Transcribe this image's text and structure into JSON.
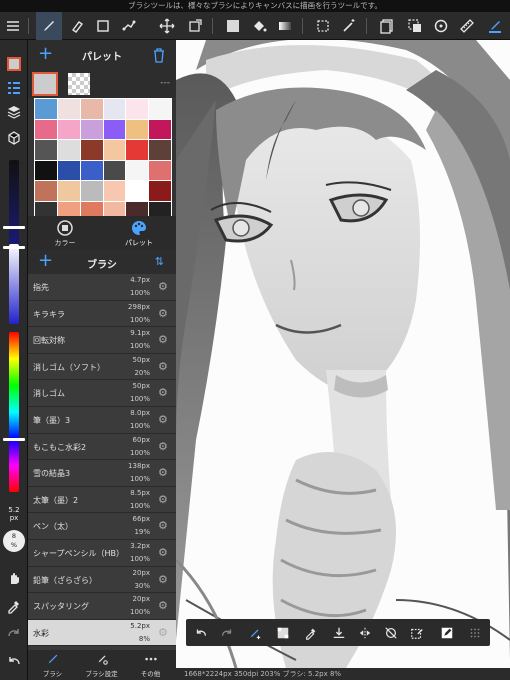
{
  "status_message": "ブラシツールは、様々なブラシによりキャンバスに描画を行うツールです。",
  "palette": {
    "title": "パレット",
    "slot_more": "---",
    "swatches": [
      "#5b9bd5",
      "#f0e0e0",
      "#e8b8a8",
      "#e6e6f0",
      "#fce4ec",
      "#f5f5f5",
      "#e86a8a",
      "#f5a6c8",
      "#c9a0dc",
      "#8b5cf6",
      "#f0c080",
      "#c2185b",
      "#555555",
      "#dddddd",
      "#8b3a2a",
      "#f4c7a1",
      "#e53935",
      "#5d4037",
      "#111111",
      "#2b4ea8",
      "#3a5fc8",
      "#4a4a4a",
      "#f5f5f5",
      "#e07070",
      "#c0735a",
      "#f0c8a0",
      "#bbbbbb",
      "#f7c7b0",
      "#ffffff",
      "#8b1a1a",
      "#333333",
      "#f0a080",
      "#e07a5f",
      "#f2b8a0",
      "#4a2a2a",
      "#222222"
    ],
    "tabs": [
      {
        "label": "カラー"
      },
      {
        "label": "パレット"
      }
    ]
  },
  "brush": {
    "title": "ブラシ",
    "items": [
      {
        "name": "指先",
        "size": "4.7px",
        "opacity": "100%"
      },
      {
        "name": "キラキラ",
        "size": "298px",
        "opacity": "100%"
      },
      {
        "name": "回転対称",
        "size": "9.1px",
        "opacity": "100%"
      },
      {
        "name": "消しゴム（ソフト）",
        "size": "50px",
        "opacity": "20%"
      },
      {
        "name": "消しゴム",
        "size": "50px",
        "opacity": "100%"
      },
      {
        "name": "筆（墨）3",
        "size": "8.0px",
        "opacity": "100%"
      },
      {
        "name": "もこもこ水彩2",
        "size": "60px",
        "opacity": "100%"
      },
      {
        "name": "雪の結晶3",
        "size": "138px",
        "opacity": "100%"
      },
      {
        "name": "太筆（墨）2",
        "size": "8.5px",
        "opacity": "100%"
      },
      {
        "name": "ペン（太）",
        "size": "66px",
        "opacity": "19%"
      },
      {
        "name": "シャープペンシル（HB）",
        "size": "3.2px",
        "opacity": "100%"
      },
      {
        "name": "鉛筆（ざらざら）",
        "size": "20px",
        "opacity": "30%"
      },
      {
        "name": "スパッタリング",
        "size": "20px",
        "opacity": "100%"
      },
      {
        "name": "水彩",
        "size": "5.2px",
        "opacity": "8%"
      }
    ],
    "tabs": [
      {
        "label": "ブラシ"
      },
      {
        "label": "ブラシ設定"
      },
      {
        "label": "その他"
      }
    ]
  },
  "left_strip": {
    "size_value": "5.2",
    "size_unit": "px",
    "opacity_value": "8",
    "opacity_unit": "%"
  },
  "canvas_info": "1668*2224px 350dpi 203% ブラシ: 5.2px 8%"
}
